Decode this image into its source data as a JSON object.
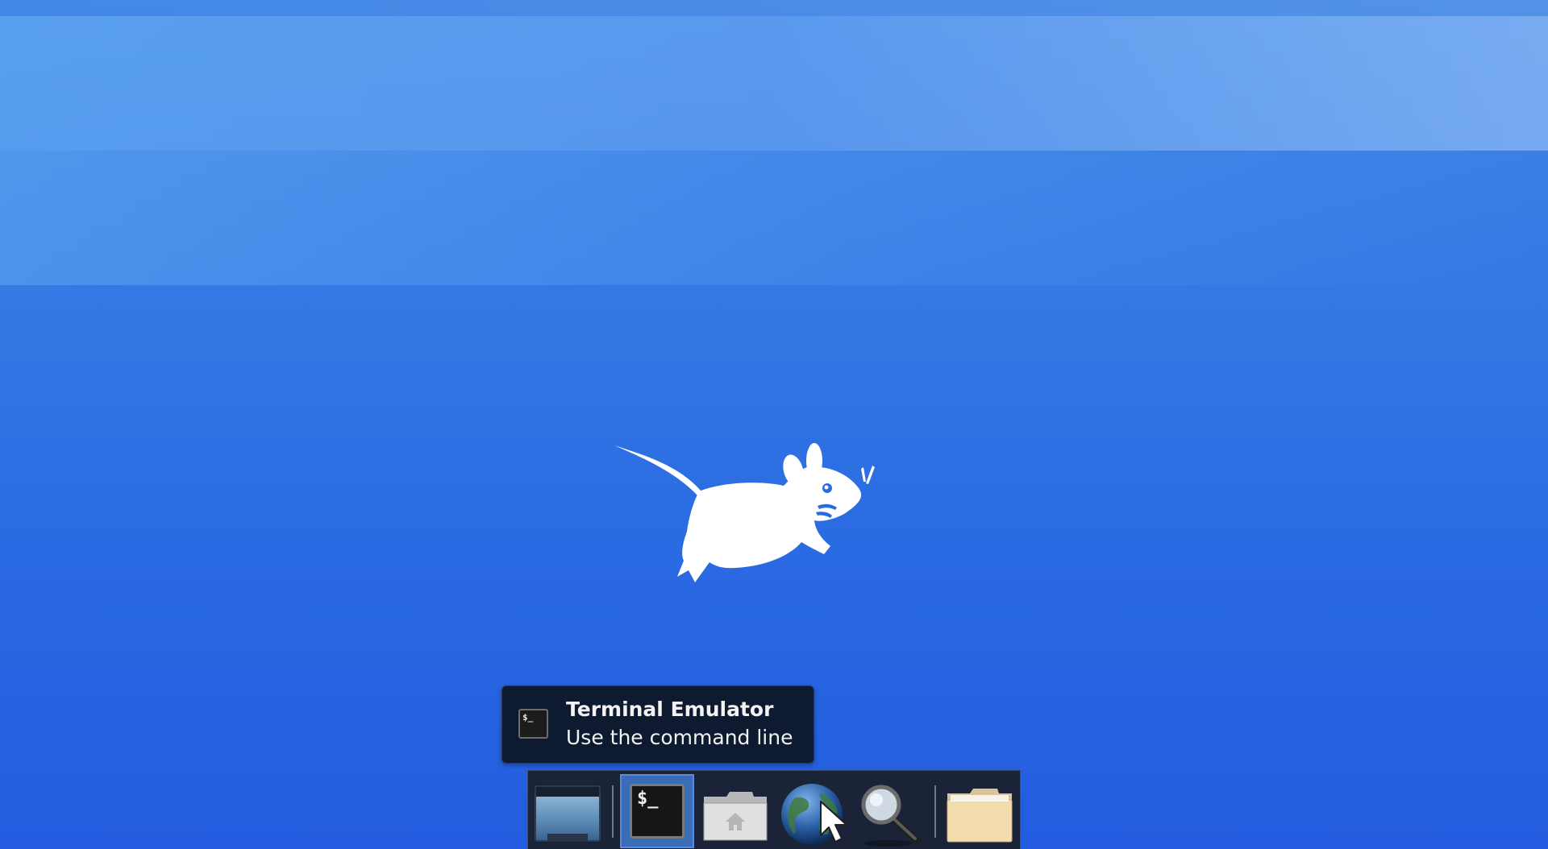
{
  "desktop": {
    "background": "#2a6ae2",
    "logo": "xfce-mouse-logo"
  },
  "tooltip": {
    "title": "Terminal Emulator",
    "subtitle": "Use the command line",
    "icon": "terminal-icon",
    "icon_glyph": "$_"
  },
  "dock": {
    "items": [
      {
        "name": "Show Desktop",
        "icon": "show-desktop-icon"
      },
      {
        "name": "Terminal Emulator",
        "icon": "terminal-icon",
        "glyph": "$_",
        "active": true
      },
      {
        "name": "Home Folder",
        "icon": "home-folder-icon"
      },
      {
        "name": "Web Browser",
        "icon": "globe-icon"
      },
      {
        "name": "Application Finder",
        "icon": "search-icon"
      },
      {
        "name": "Folder",
        "icon": "folder-icon"
      }
    ],
    "active_color": "#3b6cb8"
  }
}
